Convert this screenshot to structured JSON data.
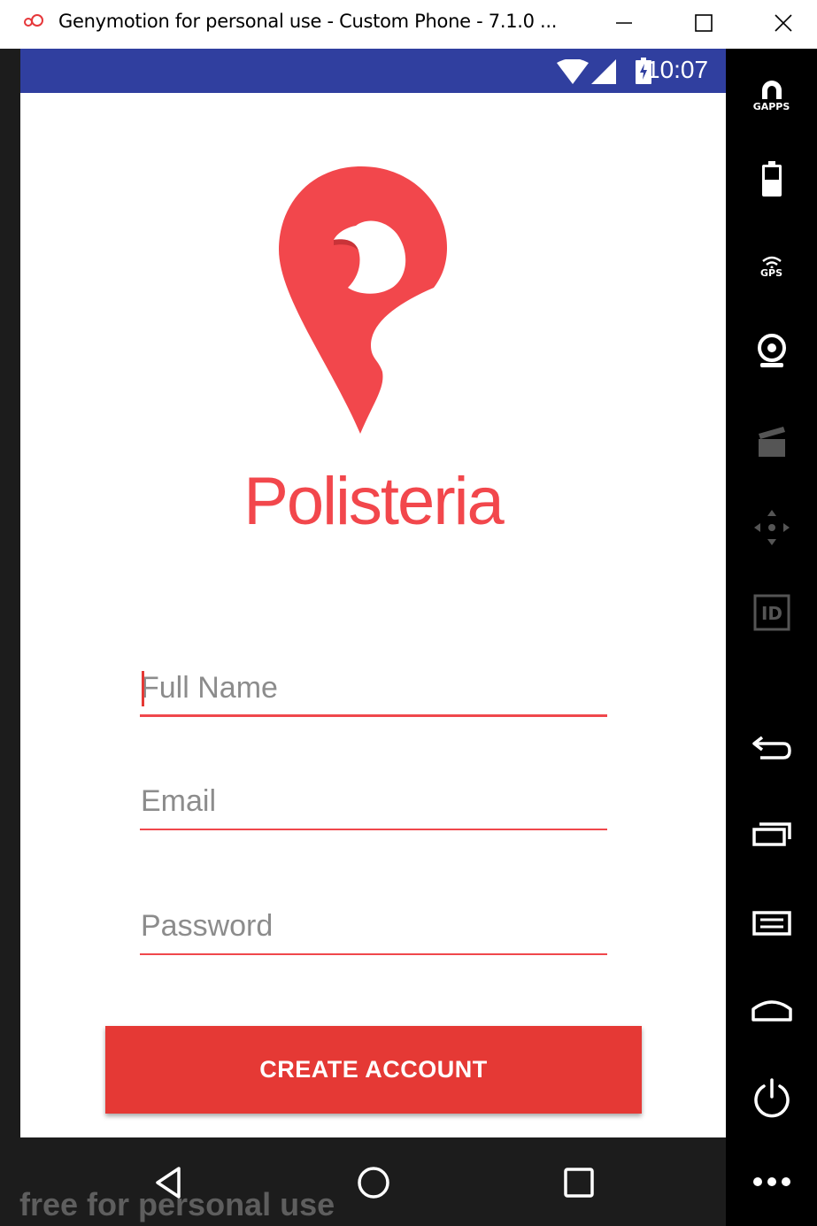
{
  "window": {
    "title": "Genymotion for personal use - Custom Phone - 7.1.0 ...",
    "icon": "genymotion-logo-icon",
    "controls": [
      "minimize-icon",
      "maximize-icon",
      "close-icon"
    ]
  },
  "status_bar": {
    "time": "10:07",
    "icons": [
      "wifi-icon",
      "signal-icon",
      "battery-charging-icon"
    ],
    "color": "#303f9f"
  },
  "app": {
    "brand_name": "Polisteria",
    "brand_color": "#f2474c",
    "logo_icon": "map-pin-logo-icon",
    "form": {
      "full_name": {
        "placeholder": "Full Name",
        "value": ""
      },
      "email": {
        "placeholder": "Email",
        "value": ""
      },
      "password": {
        "placeholder": "Password",
        "value": ""
      }
    },
    "create_account_label": "CREATE ACCOUNT",
    "button_color": "#e53935"
  },
  "nav_bar": {
    "buttons": [
      "back-icon",
      "home-icon",
      "recent-apps-icon"
    ]
  },
  "watermark": "free for personal use",
  "sidebar": {
    "tools": [
      {
        "name": "gapps",
        "label": "GAPPS"
      },
      {
        "name": "battery",
        "label": ""
      },
      {
        "name": "gps",
        "label": "GPS"
      },
      {
        "name": "webcam",
        "label": ""
      },
      {
        "name": "media",
        "label": ""
      },
      {
        "name": "dpad",
        "label": ""
      },
      {
        "name": "device-id",
        "label": "ID"
      },
      {
        "name": "back",
        "label": ""
      },
      {
        "name": "recent-apps",
        "label": ""
      },
      {
        "name": "menu",
        "label": ""
      },
      {
        "name": "home",
        "label": ""
      },
      {
        "name": "power",
        "label": ""
      },
      {
        "name": "more",
        "label": ""
      }
    ]
  }
}
